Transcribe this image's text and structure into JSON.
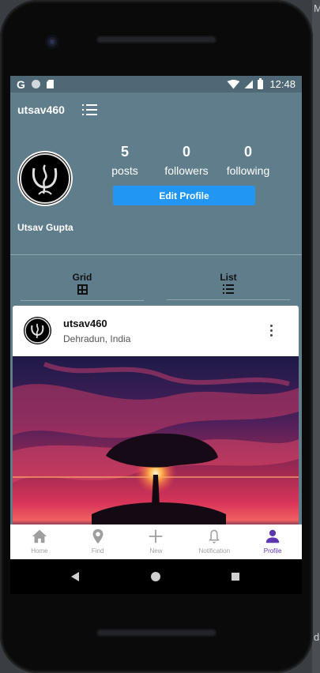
{
  "desktop": {
    "edge_letter": "M",
    "edge_letter_bottom": "d"
  },
  "statusbar": {
    "time": "12:48",
    "left_icons": [
      "g-icon",
      "circle-icon",
      "sd-card-icon"
    ],
    "right_icons": [
      "wifi-icon",
      "signal-icon",
      "battery-icon"
    ]
  },
  "profile": {
    "username": "utsav460",
    "full_name": "Utsav Gupta",
    "stats": [
      {
        "value": "5",
        "label": "posts"
      },
      {
        "value": "0",
        "label": "followers"
      },
      {
        "value": "0",
        "label": "following"
      }
    ],
    "edit_button_label": "Edit Profile",
    "view_tabs": [
      {
        "label": "Grid",
        "icon": "grid-icon"
      },
      {
        "label": "List",
        "icon": "list-icon"
      }
    ]
  },
  "post": {
    "username": "utsav460",
    "location": "Dehradun, India"
  },
  "bottom_nav": {
    "active": "Profile",
    "items": [
      {
        "label": "Home",
        "icon": "home-icon"
      },
      {
        "label": "Find",
        "icon": "location-pin-icon"
      },
      {
        "label": "New",
        "icon": "plus-icon"
      },
      {
        "label": "Notification",
        "icon": "bell-icon"
      },
      {
        "label": "Profile",
        "icon": "person-icon"
      }
    ]
  },
  "colors": {
    "header_bg": "#607d8b",
    "statusbar_bg": "#4e6876",
    "button": "#2196f3",
    "active_nav": "#5e35b1",
    "inactive_nav": "#9e9e9e"
  }
}
